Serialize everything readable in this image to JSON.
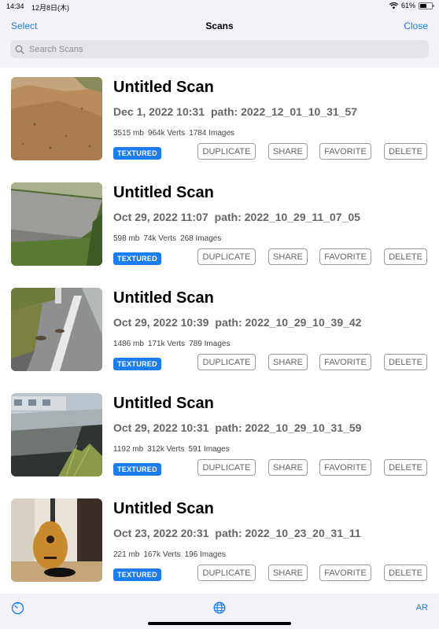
{
  "status": {
    "time": "14:34",
    "date": "12月8日(木)",
    "battery": "61%"
  },
  "nav": {
    "select_label": "Select",
    "title": "Scans",
    "close_label": "Close"
  },
  "search": {
    "placeholder": "Search Scans"
  },
  "colors": {
    "accent": "#1a7df0",
    "badge": "#1a7df0",
    "bar_bg": "#f2f2f7"
  },
  "scans": [
    {
      "title": "Untitled Scan",
      "date": "Dec 1, 2022 10:31",
      "path": "path: 2022_12_01_10_31_57",
      "size": "3515 mb",
      "verts": "964k Verts",
      "images": "1784 Images",
      "badge": "TEXTURED",
      "thumbnail": "sandy-ground"
    },
    {
      "title": "Untitled Scan",
      "date": "Oct 29, 2022 11:07",
      "path": "path: 2022_10_29_11_07_05",
      "size": "598 mb",
      "verts": "74k Verts",
      "images": "268 Images",
      "badge": "TEXTURED",
      "thumbnail": "concrete-slab"
    },
    {
      "title": "Untitled Scan",
      "date": "Oct 29, 2022 10:39",
      "path": "path: 2022_10_29_10_39_42",
      "size": "1486 mb",
      "verts": "171k Verts",
      "images": "789 Images",
      "badge": "TEXTURED",
      "thumbnail": "road"
    },
    {
      "title": "Untitled Scan",
      "date": "Oct 29, 2022 10:31",
      "path": "path: 2022_10_29_10_31_59",
      "size": "1192 mb",
      "verts": "312k Verts",
      "images": "591 Images",
      "badge": "TEXTURED",
      "thumbnail": "canal"
    },
    {
      "title": "Untitled Scan",
      "date": "Oct 23, 2022 20:31",
      "path": "path: 2022_10_23_20_31_11",
      "size": "221 mb",
      "verts": "167k Verts",
      "images": "196 Images",
      "badge": "TEXTURED",
      "thumbnail": "guitar"
    }
  ],
  "actions": {
    "duplicate": "DUPLICATE",
    "share": "SHARE",
    "favorite": "FAVORITE",
    "delete": "DELETE"
  },
  "toolbar": {
    "left_icon": "timer-icon",
    "center_icon": "globe-icon",
    "ar_label": "AR"
  }
}
